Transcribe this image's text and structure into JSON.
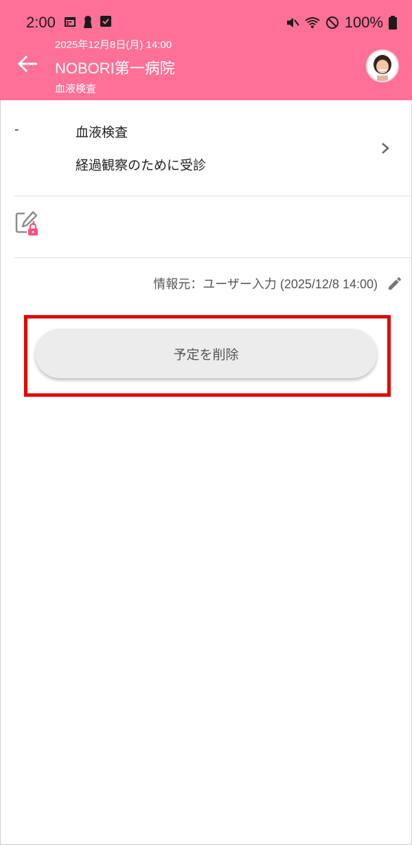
{
  "status_bar": {
    "time": "2:00",
    "battery": "100%"
  },
  "header": {
    "datetime": "2025年12月8日(月) 14:00",
    "title": "NOBORI第一病院",
    "subtitle": "血液検査"
  },
  "detail": {
    "dash": "-",
    "name": "血液検査",
    "purpose": "経過観察のために受診"
  },
  "info": {
    "source": "情報元：ユーザー入力 (2025/12/8 14:00)"
  },
  "actions": {
    "delete_label": "予定を削除"
  },
  "colors": {
    "appbar": "#ff7096",
    "highlight": "#e60000",
    "lock": "#ff4d7a"
  }
}
